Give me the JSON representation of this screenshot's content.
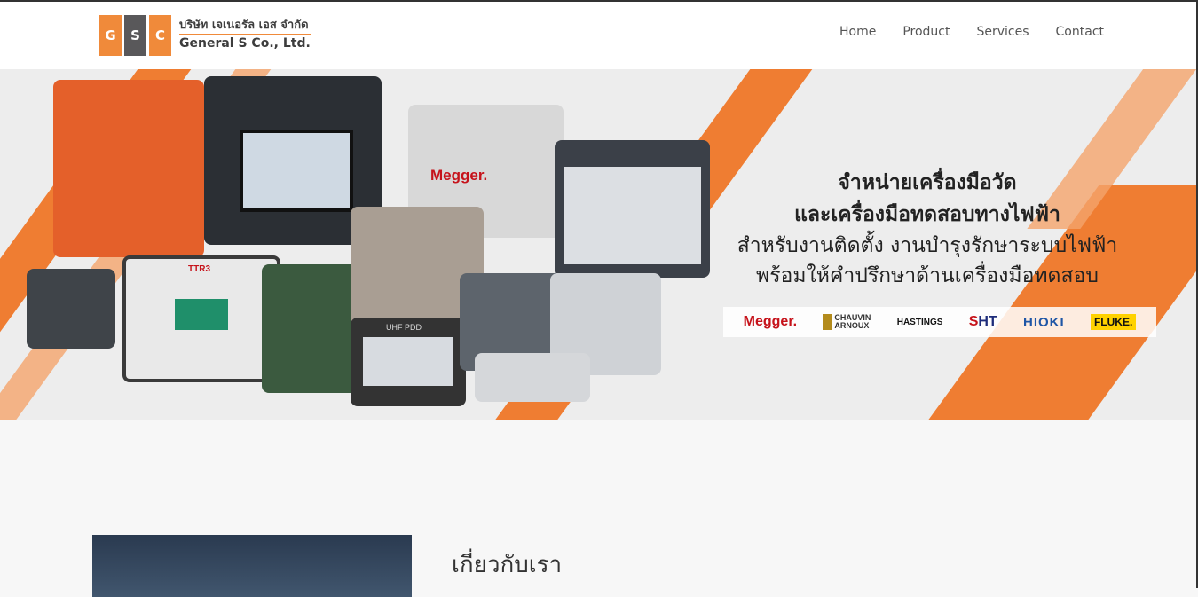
{
  "logo": {
    "letters": [
      "G",
      "S",
      "C"
    ],
    "thai_name": "บริษัท เจเนอรัล เอส จำกัด",
    "english_name": "General S Co., Ltd."
  },
  "nav": {
    "items": [
      "Home",
      "Product",
      "Services",
      "Contact"
    ]
  },
  "hero": {
    "line1": "จำหน่ายเครื่องมือวัด",
    "line2": "และเครื่องมือทดสอบทางไฟฟ้า",
    "line3": "สำหรับงานติดตั้ง งานบำรุงรักษาระบบไฟฟ้า",
    "line4": "พร้อมให้คำปรึกษาด้านเครื่องมือทดสอบ",
    "brands": {
      "megger": "Megger.",
      "chauvin_1": "CHAUVIN",
      "chauvin_2": "ARNOUX",
      "hastings": "HASTINGS",
      "sht_s": "S",
      "sht_ht": "HT",
      "hioki": "HIOKI",
      "fluke": "FLUKE."
    },
    "equipment_labels": {
      "megger_label": "Megger.",
      "ttr_label": "TTR3",
      "uhf_label": "UHF PDD"
    },
    "colors": {
      "accent": "#ef7d32",
      "background": "#ededed"
    }
  },
  "about": {
    "title": "เกี่ยวกับเรา"
  }
}
